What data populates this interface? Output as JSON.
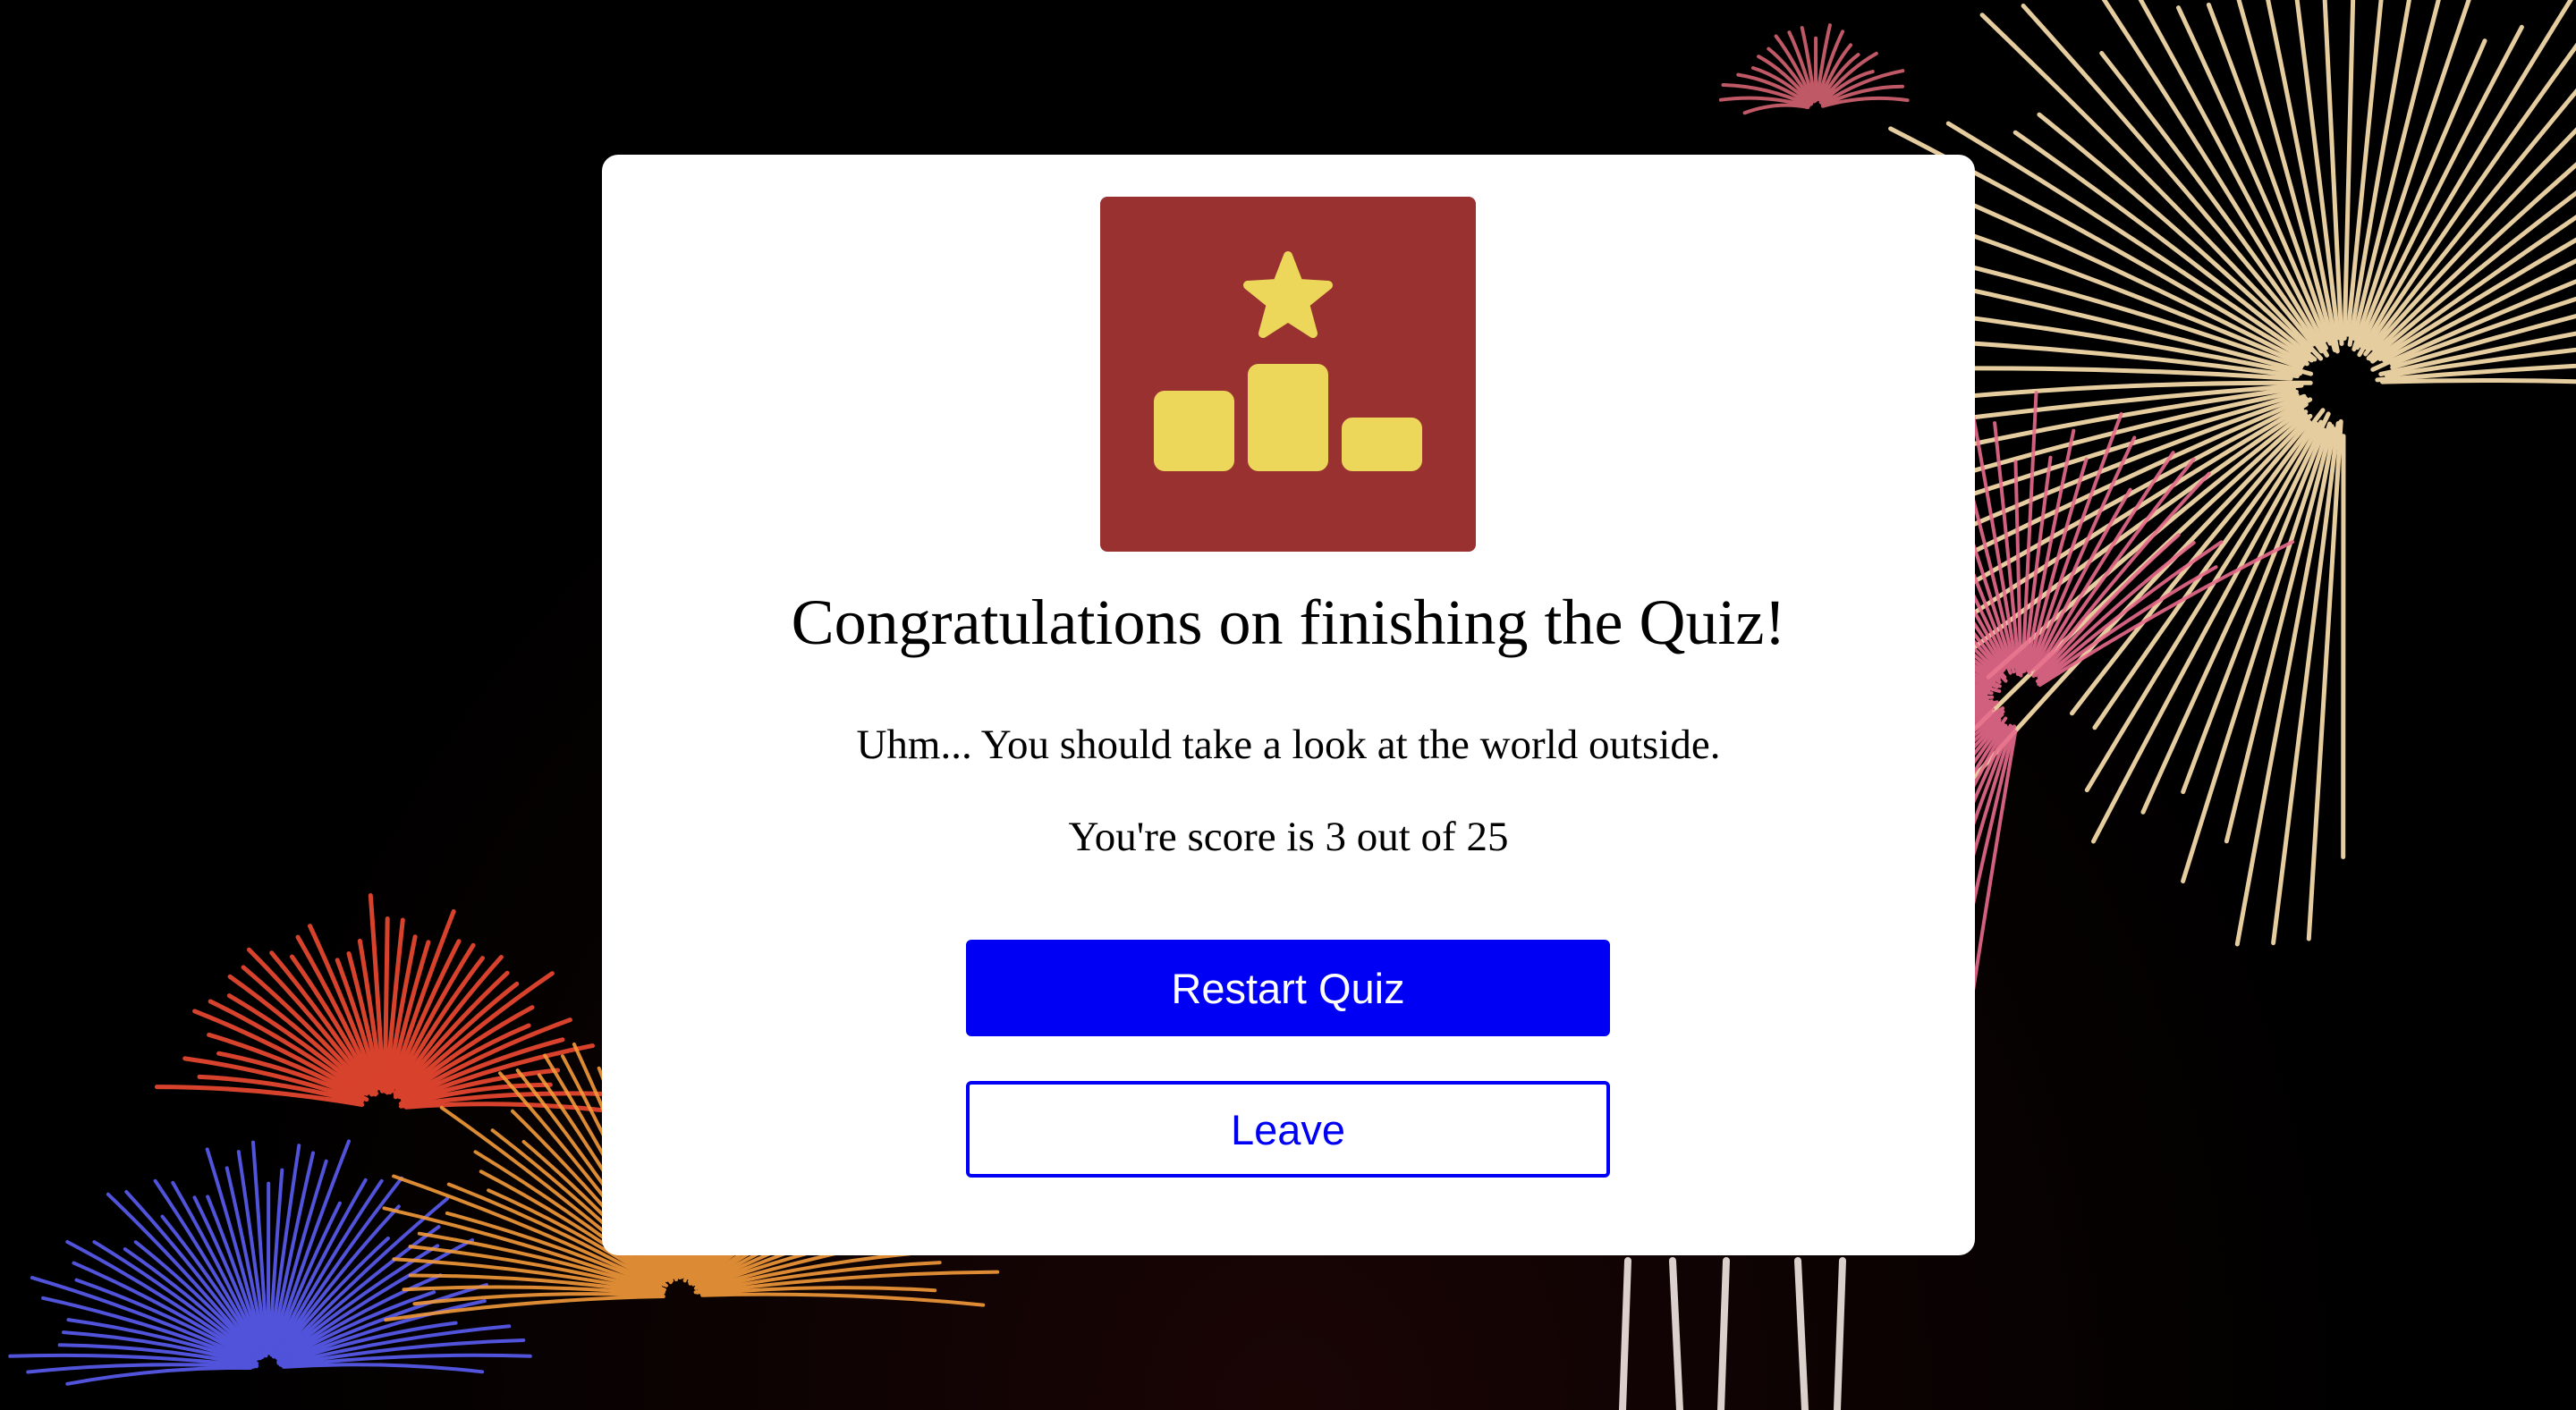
{
  "quiz_result": {
    "headline": "Congratulations on finishing the Quiz!",
    "message": "Uhm... You should take a look at the world outside.",
    "score_text": "You're score is 3 out of 25",
    "score": 3,
    "total": 25
  },
  "actions": {
    "restart_label": "Restart Quiz",
    "leave_label": "Leave"
  },
  "icons": {
    "trophy_tile": "podium-star-icon"
  },
  "colors": {
    "tile_background": "#993131",
    "icon_fill": "#ecd75a",
    "primary": "#0000f5",
    "card": "#ffffff",
    "page_background": "#000000"
  }
}
